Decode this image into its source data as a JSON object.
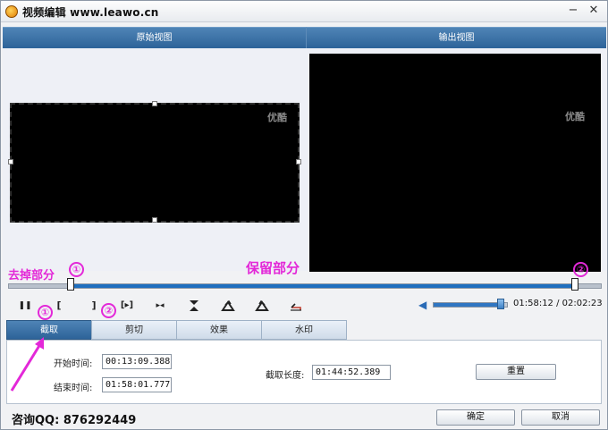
{
  "window": {
    "title": "视频编辑 www.leawo.cn",
    "min_glyph": "−",
    "close_glyph": "✕"
  },
  "views": {
    "original_label": "原始视图",
    "output_label": "输出视图",
    "watermark": "优酷"
  },
  "annotations": {
    "remove_part": "去掉部分",
    "keep_part": "保留部分",
    "marker_1": "①",
    "marker_2": "②"
  },
  "timeline": {
    "start_fraction": 0.105,
    "end_fraction": 0.955
  },
  "controls": {
    "pause_glyph": "❚❚",
    "set_start_glyph": "[",
    "set_end_glyph": "]",
    "next_glyph": "[▸]",
    "split_glyph": "▸◂",
    "icons": [
      "pause-icon",
      "set-start-icon",
      "set-end-icon",
      "next-frame-icon",
      "split-icon",
      "trim-icon",
      "rotate-left-icon",
      "rotate-right-icon",
      "undo-icon"
    ],
    "volume_level": 0.95,
    "time_current": "01:58:12",
    "time_total": "02:02:23",
    "time_display": "01:58:12 / 02:02:23"
  },
  "tabs": [
    {
      "label": "截取",
      "active": true
    },
    {
      "label": "剪切",
      "active": false
    },
    {
      "label": "效果",
      "active": false
    },
    {
      "label": "水印",
      "active": false
    }
  ],
  "trim_panel": {
    "start_label": "开始时间:",
    "start_value": "00:13:09.388",
    "end_label": "结束时间:",
    "end_value": "01:58:01.777",
    "length_label": "截取长度:",
    "length_value": "01:44:52.389",
    "reset_label": "重置"
  },
  "footer": {
    "qq_text": "咨询QQ:  876292449",
    "ok_label": "确定",
    "cancel_label": "取消"
  },
  "colors": {
    "accent": "#2d6399",
    "annotation": "#e328d8"
  }
}
